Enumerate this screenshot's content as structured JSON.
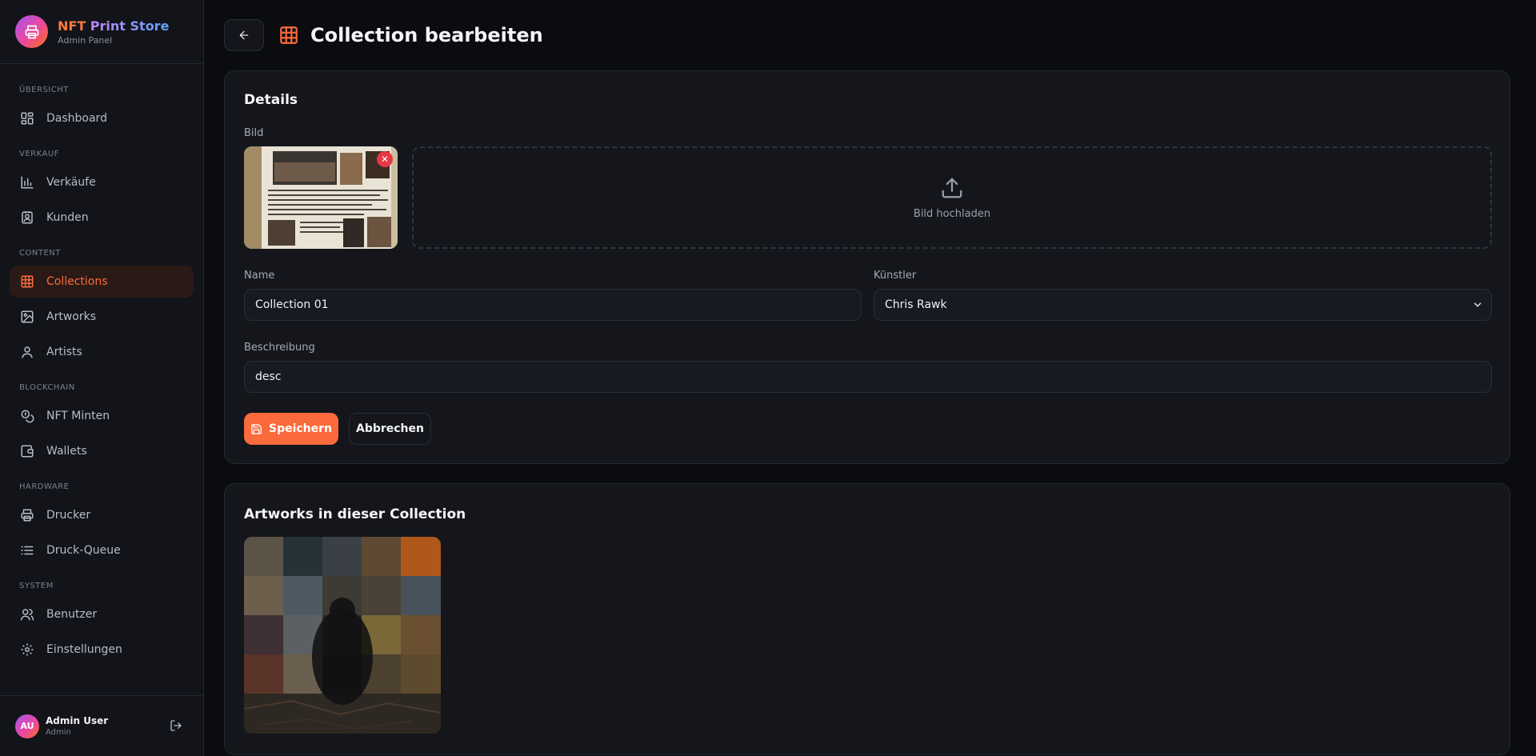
{
  "brand": {
    "title_part1": "NFT",
    "title_part2": " Print Store",
    "subtitle": "Admin Panel"
  },
  "sidebar": {
    "sections": [
      {
        "label": "Übersicht",
        "items": [
          {
            "label": "Dashboard",
            "icon": "dashboard-icon"
          }
        ]
      },
      {
        "label": "Verkauf",
        "items": [
          {
            "label": "Verkäufe",
            "icon": "bar-chart-icon"
          },
          {
            "label": "Kunden",
            "icon": "contact-card-icon"
          }
        ]
      },
      {
        "label": "Content",
        "items": [
          {
            "label": "Collections",
            "icon": "grid-icon",
            "active": true
          },
          {
            "label": "Artworks",
            "icon": "image-icon"
          },
          {
            "label": "Artists",
            "icon": "user-icon"
          }
        ]
      },
      {
        "label": "Blockchain",
        "items": [
          {
            "label": "NFT Minten",
            "icon": "coins-icon"
          },
          {
            "label": "Wallets",
            "icon": "wallet-icon"
          }
        ]
      },
      {
        "label": "Hardware",
        "items": [
          {
            "label": "Drucker",
            "icon": "printer-icon"
          },
          {
            "label": "Druck-Queue",
            "icon": "list-icon"
          }
        ]
      },
      {
        "label": "System",
        "items": [
          {
            "label": "Benutzer",
            "icon": "users-icon"
          },
          {
            "label": "Einstellungen",
            "icon": "gear-icon"
          }
        ]
      }
    ]
  },
  "user": {
    "initials": "AU",
    "name": "Admin User",
    "role": "Admin"
  },
  "header": {
    "title": "Collection bearbeiten"
  },
  "details": {
    "title": "Details",
    "image_label": "Bild",
    "upload_label": "Bild hochladen",
    "remove_symbol": "✕",
    "name_label": "Name",
    "name_value": "Collection 01",
    "artist_label": "Künstler",
    "artist_value": "Chris Rawk",
    "description_label": "Beschreibung",
    "description_value": "desc",
    "save_label": "Speichern",
    "cancel_label": "Abbrechen"
  },
  "artworks_section": {
    "title": "Artworks in dieser Collection"
  },
  "colors": {
    "accent": "#fb6a3c",
    "background": "#0b0c0f",
    "card": "#14161c",
    "danger": "#e53945"
  }
}
